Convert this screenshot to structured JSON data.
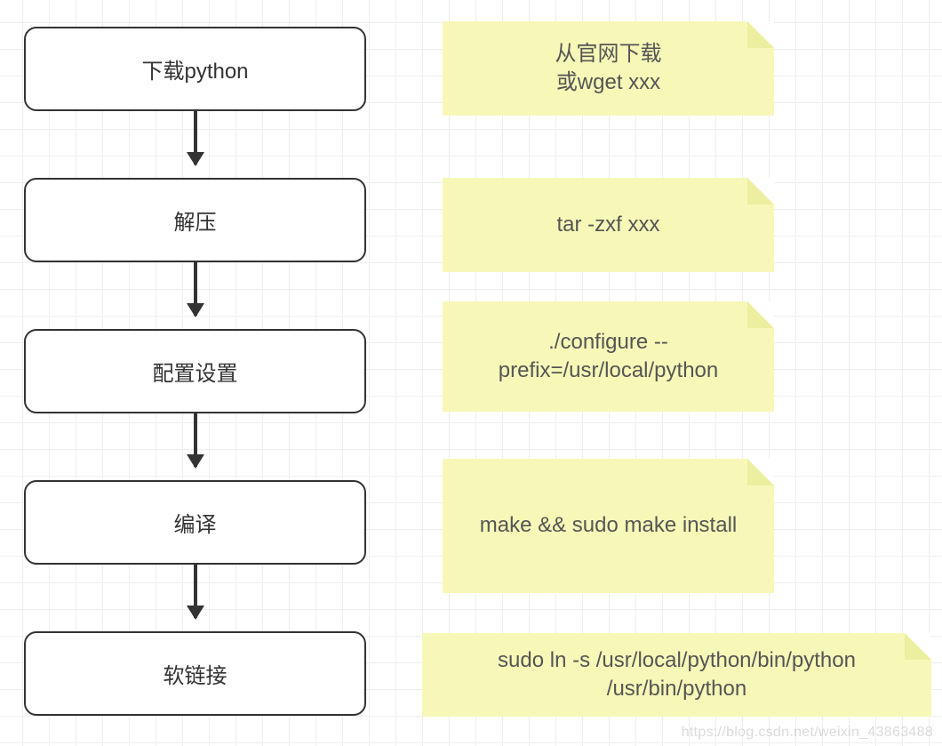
{
  "steps": [
    {
      "label": "下载python",
      "note": "从官网下载\n或wget xxx"
    },
    {
      "label": "解压",
      "note": "tar -zxf xxx"
    },
    {
      "label": "配置设置",
      "note": "./configure --\nprefix=/usr/local/python"
    },
    {
      "label": "编译",
      "note": "make && sudo make install"
    },
    {
      "label": "软链接",
      "note": "sudo ln -s /usr/local/python/bin/python\n/usr/bin/python"
    }
  ],
  "watermark": "https://blog.csdn.net/weixin_43863488"
}
